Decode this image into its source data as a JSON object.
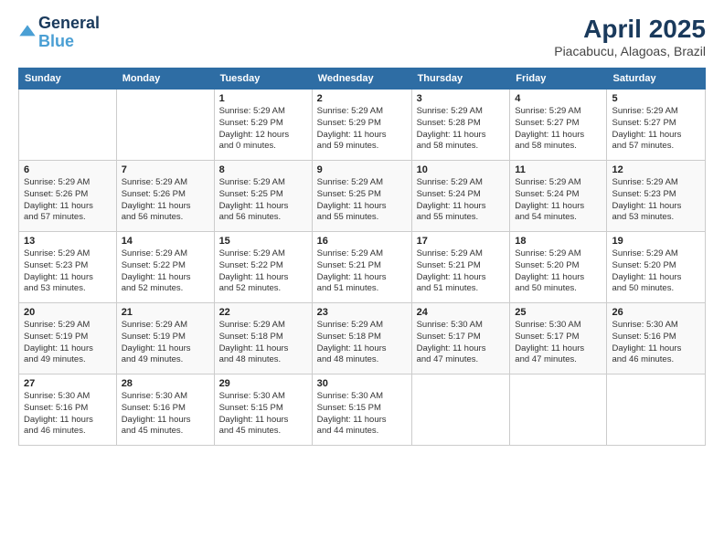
{
  "logo": {
    "line1": "General",
    "line2": "Blue"
  },
  "title": "April 2025",
  "subtitle": "Piacabucu, Alagoas, Brazil",
  "headers": [
    "Sunday",
    "Monday",
    "Tuesday",
    "Wednesday",
    "Thursday",
    "Friday",
    "Saturday"
  ],
  "weeks": [
    [
      {
        "day": "",
        "info": ""
      },
      {
        "day": "",
        "info": ""
      },
      {
        "day": "1",
        "info": "Sunrise: 5:29 AM\nSunset: 5:29 PM\nDaylight: 12 hours\nand 0 minutes."
      },
      {
        "day": "2",
        "info": "Sunrise: 5:29 AM\nSunset: 5:29 PM\nDaylight: 11 hours\nand 59 minutes."
      },
      {
        "day": "3",
        "info": "Sunrise: 5:29 AM\nSunset: 5:28 PM\nDaylight: 11 hours\nand 58 minutes."
      },
      {
        "day": "4",
        "info": "Sunrise: 5:29 AM\nSunset: 5:27 PM\nDaylight: 11 hours\nand 58 minutes."
      },
      {
        "day": "5",
        "info": "Sunrise: 5:29 AM\nSunset: 5:27 PM\nDaylight: 11 hours\nand 57 minutes."
      }
    ],
    [
      {
        "day": "6",
        "info": "Sunrise: 5:29 AM\nSunset: 5:26 PM\nDaylight: 11 hours\nand 57 minutes."
      },
      {
        "day": "7",
        "info": "Sunrise: 5:29 AM\nSunset: 5:26 PM\nDaylight: 11 hours\nand 56 minutes."
      },
      {
        "day": "8",
        "info": "Sunrise: 5:29 AM\nSunset: 5:25 PM\nDaylight: 11 hours\nand 56 minutes."
      },
      {
        "day": "9",
        "info": "Sunrise: 5:29 AM\nSunset: 5:25 PM\nDaylight: 11 hours\nand 55 minutes."
      },
      {
        "day": "10",
        "info": "Sunrise: 5:29 AM\nSunset: 5:24 PM\nDaylight: 11 hours\nand 55 minutes."
      },
      {
        "day": "11",
        "info": "Sunrise: 5:29 AM\nSunset: 5:24 PM\nDaylight: 11 hours\nand 54 minutes."
      },
      {
        "day": "12",
        "info": "Sunrise: 5:29 AM\nSunset: 5:23 PM\nDaylight: 11 hours\nand 53 minutes."
      }
    ],
    [
      {
        "day": "13",
        "info": "Sunrise: 5:29 AM\nSunset: 5:23 PM\nDaylight: 11 hours\nand 53 minutes."
      },
      {
        "day": "14",
        "info": "Sunrise: 5:29 AM\nSunset: 5:22 PM\nDaylight: 11 hours\nand 52 minutes."
      },
      {
        "day": "15",
        "info": "Sunrise: 5:29 AM\nSunset: 5:22 PM\nDaylight: 11 hours\nand 52 minutes."
      },
      {
        "day": "16",
        "info": "Sunrise: 5:29 AM\nSunset: 5:21 PM\nDaylight: 11 hours\nand 51 minutes."
      },
      {
        "day": "17",
        "info": "Sunrise: 5:29 AM\nSunset: 5:21 PM\nDaylight: 11 hours\nand 51 minutes."
      },
      {
        "day": "18",
        "info": "Sunrise: 5:29 AM\nSunset: 5:20 PM\nDaylight: 11 hours\nand 50 minutes."
      },
      {
        "day": "19",
        "info": "Sunrise: 5:29 AM\nSunset: 5:20 PM\nDaylight: 11 hours\nand 50 minutes."
      }
    ],
    [
      {
        "day": "20",
        "info": "Sunrise: 5:29 AM\nSunset: 5:19 PM\nDaylight: 11 hours\nand 49 minutes."
      },
      {
        "day": "21",
        "info": "Sunrise: 5:29 AM\nSunset: 5:19 PM\nDaylight: 11 hours\nand 49 minutes."
      },
      {
        "day": "22",
        "info": "Sunrise: 5:29 AM\nSunset: 5:18 PM\nDaylight: 11 hours\nand 48 minutes."
      },
      {
        "day": "23",
        "info": "Sunrise: 5:29 AM\nSunset: 5:18 PM\nDaylight: 11 hours\nand 48 minutes."
      },
      {
        "day": "24",
        "info": "Sunrise: 5:30 AM\nSunset: 5:17 PM\nDaylight: 11 hours\nand 47 minutes."
      },
      {
        "day": "25",
        "info": "Sunrise: 5:30 AM\nSunset: 5:17 PM\nDaylight: 11 hours\nand 47 minutes."
      },
      {
        "day": "26",
        "info": "Sunrise: 5:30 AM\nSunset: 5:16 PM\nDaylight: 11 hours\nand 46 minutes."
      }
    ],
    [
      {
        "day": "27",
        "info": "Sunrise: 5:30 AM\nSunset: 5:16 PM\nDaylight: 11 hours\nand 46 minutes."
      },
      {
        "day": "28",
        "info": "Sunrise: 5:30 AM\nSunset: 5:16 PM\nDaylight: 11 hours\nand 45 minutes."
      },
      {
        "day": "29",
        "info": "Sunrise: 5:30 AM\nSunset: 5:15 PM\nDaylight: 11 hours\nand 45 minutes."
      },
      {
        "day": "30",
        "info": "Sunrise: 5:30 AM\nSunset: 5:15 PM\nDaylight: 11 hours\nand 44 minutes."
      },
      {
        "day": "",
        "info": ""
      },
      {
        "day": "",
        "info": ""
      },
      {
        "day": "",
        "info": ""
      }
    ]
  ]
}
